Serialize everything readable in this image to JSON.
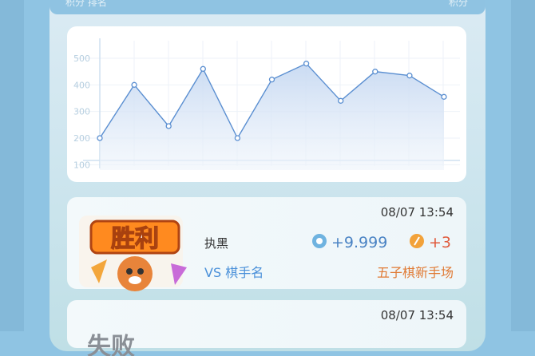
{
  "topbar": {
    "left_text": "积分  排名",
    "right_text": "积分"
  },
  "chart_data": {
    "type": "area",
    "x": [
      1,
      2,
      3,
      4,
      5,
      6,
      7,
      8,
      9,
      10,
      11
    ],
    "values": [
      200,
      400,
      245,
      460,
      200,
      420,
      480,
      340,
      450,
      435,
      355
    ],
    "yticks": [
      100,
      200,
      300,
      400,
      500
    ],
    "ylim": [
      80,
      560
    ],
    "grid": true,
    "line_color": "#5b8fd1"
  },
  "matches": [
    {
      "result": "胜利",
      "time": "08/07 13:54",
      "color_label": "执黑",
      "vs_text": "VS 棋手名",
      "score_delta": "+9.999",
      "coin_delta": "+3",
      "room": "五子棋新手场"
    },
    {
      "result": "失败",
      "time": "08/07 13:54"
    }
  ]
}
